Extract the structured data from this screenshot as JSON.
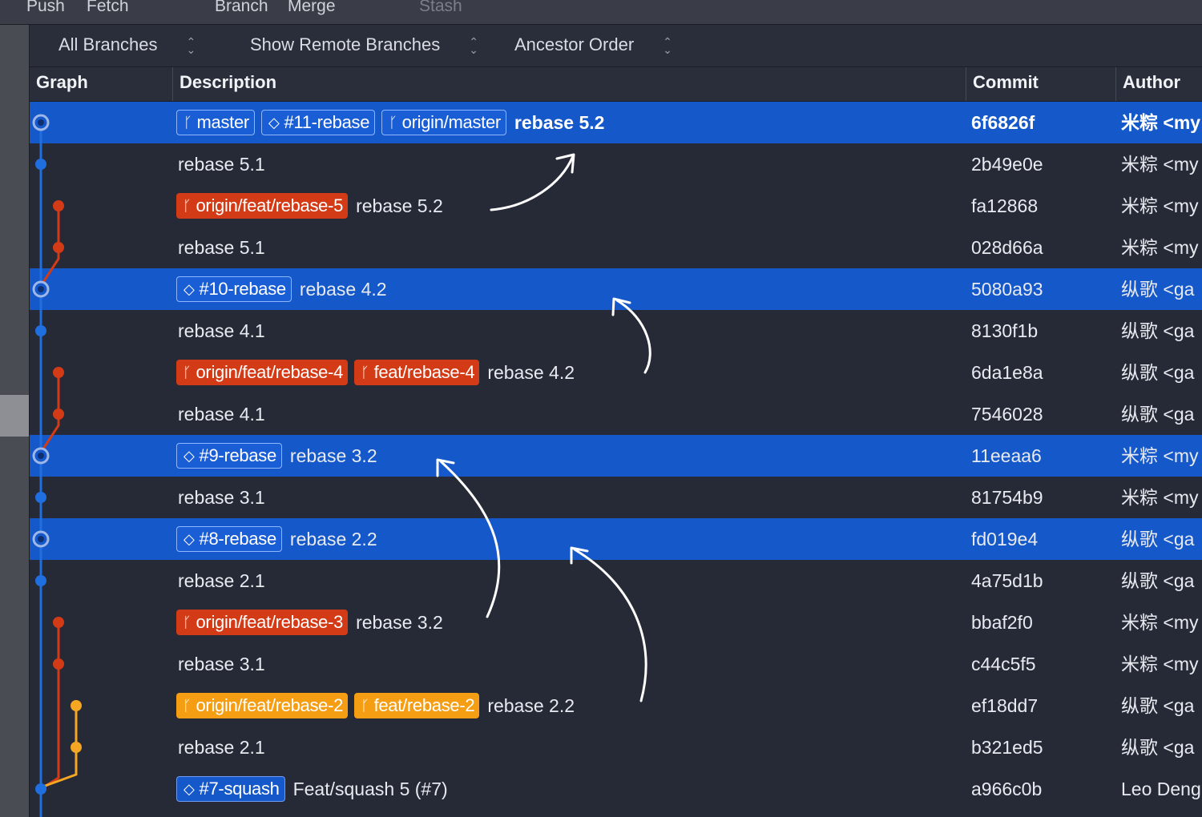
{
  "toolbar": {
    "items": [
      {
        "label": "Push",
        "enabled": true
      },
      {
        "label": "Fetch",
        "enabled": true
      },
      {
        "label": "Branch",
        "enabled": true
      },
      {
        "label": "Merge",
        "enabled": true
      },
      {
        "label": "Stash",
        "enabled": false
      }
    ]
  },
  "filters": {
    "branches": "All Branches",
    "remote": "Show Remote Branches",
    "order": "Ancestor Order"
  },
  "columns": {
    "graph": "Graph",
    "description": "Description",
    "commit": "Commit",
    "author": "Author"
  },
  "colors": {
    "selection": "#1458c9",
    "lane_main": "#1f6fe0",
    "lane_red": "#d33b16",
    "lane_orange": "#f5a623"
  },
  "commits": [
    {
      "badges": [
        {
          "kind": "branch",
          "color": "blue",
          "label": "master"
        },
        {
          "kind": "tag",
          "color": "blue",
          "label": "#11-rebase"
        },
        {
          "kind": "branch",
          "color": "blue",
          "label": "origin/master"
        }
      ],
      "message": "rebase 5.2",
      "hash": "6f6826f",
      "author": "米粽 <my",
      "selected": true,
      "head": true
    },
    {
      "badges": [],
      "message": "rebase 5.1",
      "hash": "2b49e0e",
      "author": "米粽 <my",
      "selected": false
    },
    {
      "badges": [
        {
          "kind": "branch",
          "color": "red",
          "label": "origin/feat/rebase-5"
        }
      ],
      "message": "rebase 5.2",
      "hash": "fa12868",
      "author": "米粽 <my",
      "selected": false
    },
    {
      "badges": [],
      "message": "rebase 5.1",
      "hash": "028d66a",
      "author": "米粽 <my",
      "selected": false
    },
    {
      "badges": [
        {
          "kind": "tag",
          "color": "blue",
          "label": "#10-rebase"
        }
      ],
      "message": "rebase 4.2",
      "hash": "5080a93",
      "author": "纵歌 <ga",
      "selected": true
    },
    {
      "badges": [],
      "message": "rebase 4.1",
      "hash": "8130f1b",
      "author": "纵歌 <ga",
      "selected": false
    },
    {
      "badges": [
        {
          "kind": "branch",
          "color": "red",
          "label": "origin/feat/rebase-4"
        },
        {
          "kind": "branch",
          "color": "red",
          "label": "feat/rebase-4"
        }
      ],
      "message": "rebase 4.2",
      "hash": "6da1e8a",
      "author": "纵歌 <ga",
      "selected": false
    },
    {
      "badges": [],
      "message": "rebase 4.1",
      "hash": "7546028",
      "author": "纵歌 <ga",
      "selected": false
    },
    {
      "badges": [
        {
          "kind": "tag",
          "color": "blue",
          "label": "#9-rebase"
        }
      ],
      "message": "rebase 3.2",
      "hash": "11eeaa6",
      "author": "米粽 <my",
      "selected": true
    },
    {
      "badges": [],
      "message": "rebase 3.1",
      "hash": "81754b9",
      "author": "米粽 <my",
      "selected": false
    },
    {
      "badges": [
        {
          "kind": "tag",
          "color": "blue",
          "label": "#8-rebase"
        }
      ],
      "message": "rebase 2.2",
      "hash": "fd019e4",
      "author": "纵歌 <ga",
      "selected": true
    },
    {
      "badges": [],
      "message": "rebase 2.1",
      "hash": "4a75d1b",
      "author": "纵歌 <ga",
      "selected": false
    },
    {
      "badges": [
        {
          "kind": "branch",
          "color": "red",
          "label": "origin/feat/rebase-3"
        }
      ],
      "message": "rebase 3.2",
      "hash": "bbaf2f0",
      "author": "米粽 <my",
      "selected": false
    },
    {
      "badges": [],
      "message": "rebase 3.1",
      "hash": "c44c5f5",
      "author": "米粽 <my",
      "selected": false
    },
    {
      "badges": [
        {
          "kind": "branch",
          "color": "orange",
          "label": "origin/feat/rebase-2"
        },
        {
          "kind": "branch",
          "color": "orange",
          "label": "feat/rebase-2"
        }
      ],
      "message": "rebase 2.2",
      "hash": "ef18dd7",
      "author": "纵歌 <ga",
      "selected": false
    },
    {
      "badges": [],
      "message": "rebase 2.1",
      "hash": "b321ed5",
      "author": "纵歌 <ga",
      "selected": false
    },
    {
      "badges": [
        {
          "kind": "tag",
          "color": "blue",
          "label": "#7-squash"
        }
      ],
      "message": "Feat/squash 5 (#7)",
      "hash": "a966c0b",
      "author": "Leo Deng",
      "selected": false
    }
  ]
}
